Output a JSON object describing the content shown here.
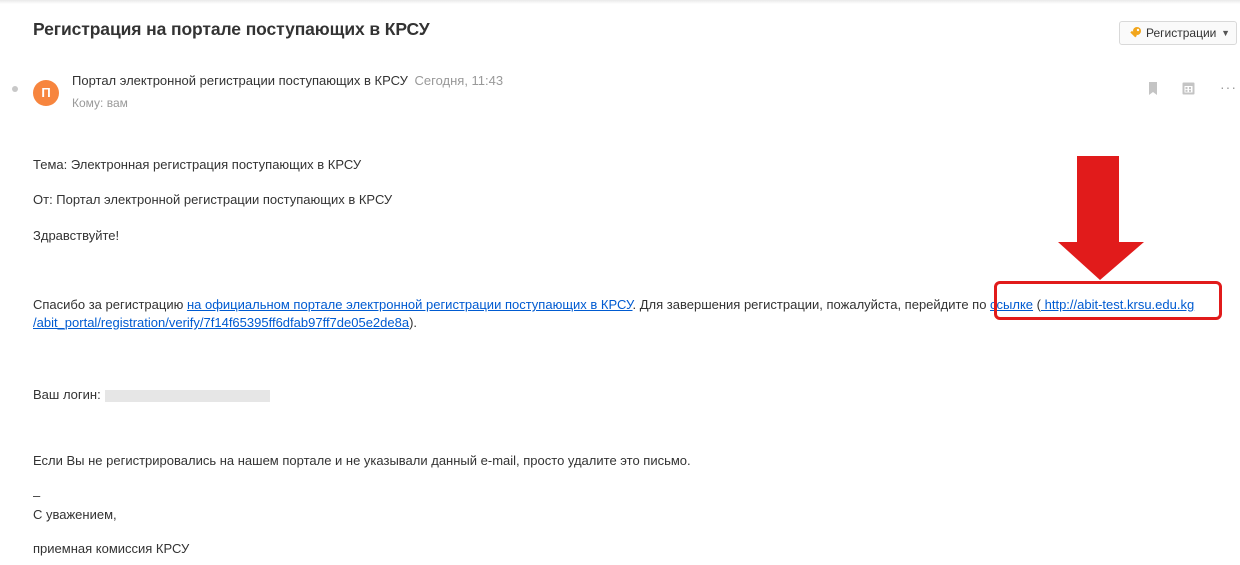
{
  "email": {
    "subject": "Регистрация на портале поступающих в КРСУ",
    "folder_button": {
      "label": "Регистрации",
      "icon": "key-icon",
      "caret": "▼"
    },
    "sender": {
      "avatar_letter": "П",
      "avatar_color": "#f7853e",
      "name": "Портал электронной регистрации поступающих в КРСУ",
      "date": "Сегодня, 11:43",
      "to": "Кому: вам"
    },
    "actions": {
      "bookmark": "bookmark-icon",
      "calendar": "calendar-icon",
      "more": "···"
    }
  },
  "body": {
    "line_theme": "Тема: Электронная регистрация поступающих в КРСУ",
    "line_from": "От: Портал электронной регистрации поступающих в КРСУ",
    "greeting": "Здравствуйте!",
    "thanks_prefix": "Спасибо за регистрацию ",
    "portal_link": "на официальном портале электронной регистрации поступающих в КРСУ",
    "thanks_middle": ". Для завершения регистрации, пожалуйста, перейдите по ",
    "ssylke_link": "ссылке",
    "paren_open": " (",
    "url_part1": " http://abit-test.krsu.edu.kg",
    "url_part2": "/abit_portal/registration/verify/7f14f65395ff6dfab97ff7de05e2de8a",
    "paren_close": ").",
    "login_label": "Ваш логин:",
    "ignore_note": "Если Вы не регистрировались на нашем портале и не указывали данный e-mail, просто удалите это письмо.",
    "dash": "–",
    "regards": "С уважением,",
    "signature": "приемная комиссия КРСУ"
  },
  "annotation": {
    "color": "#e11b1b"
  }
}
